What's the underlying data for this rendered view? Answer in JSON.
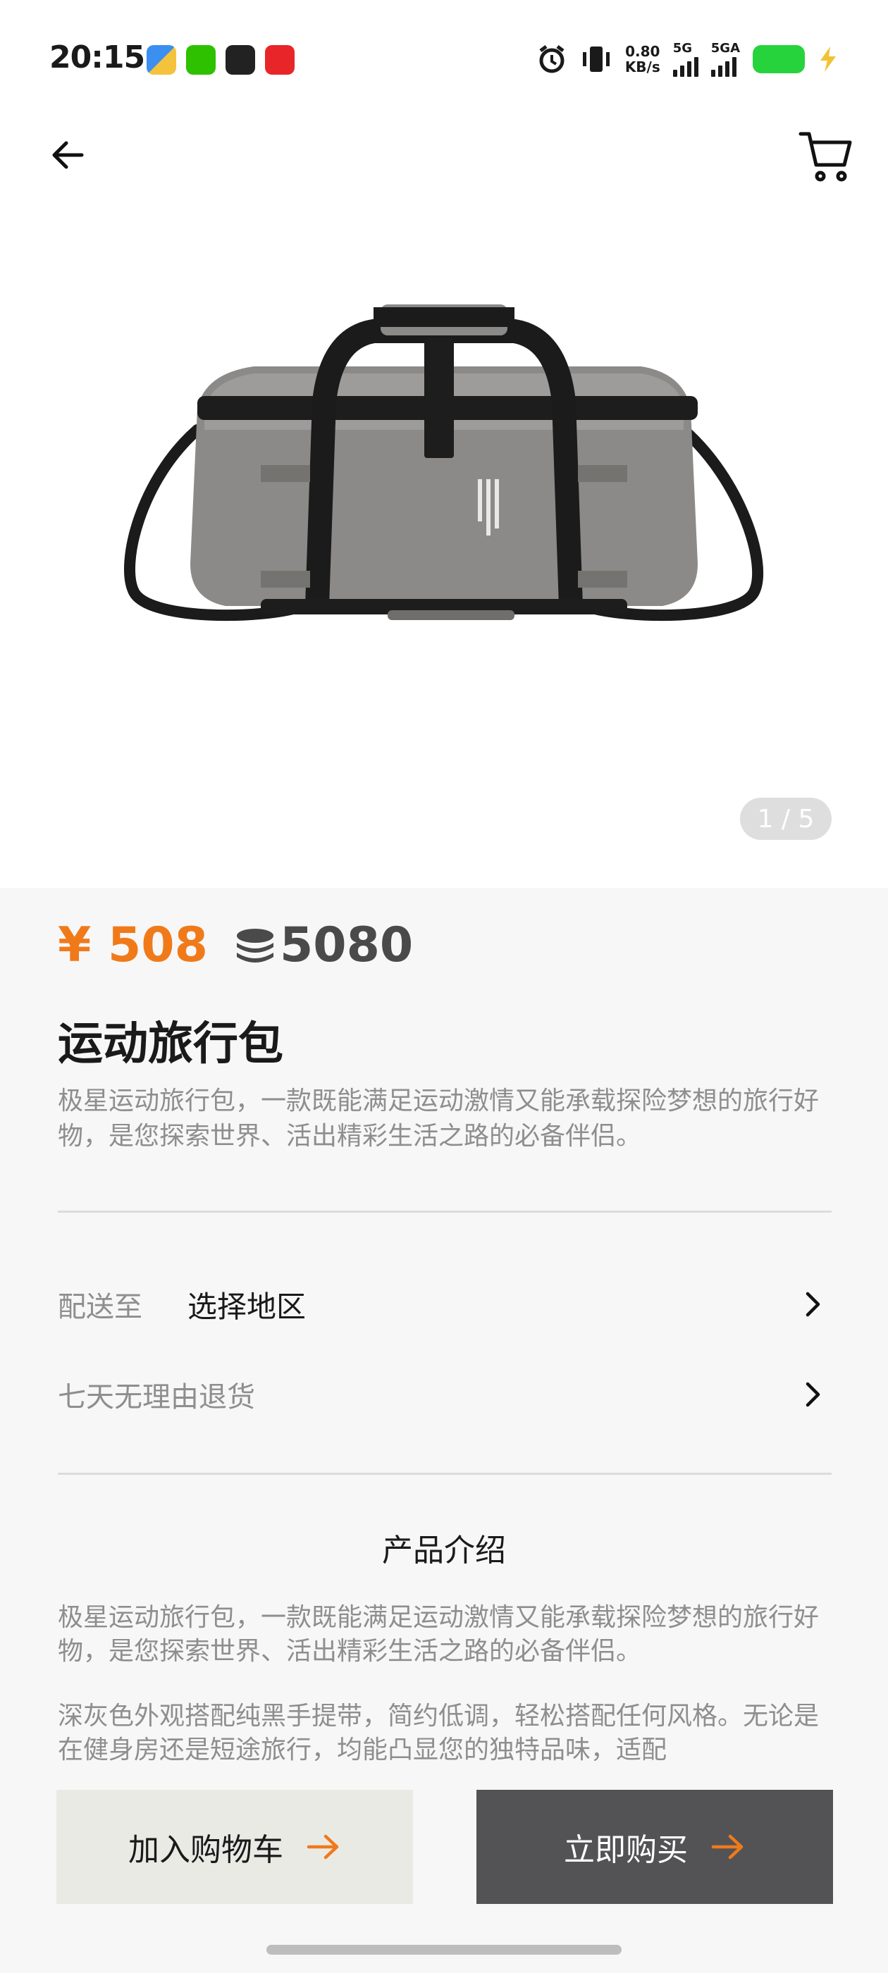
{
  "status_bar": {
    "time": "20:15",
    "net_speed_value": "0.80",
    "net_speed_unit": "KB/s",
    "signal1_label": "5G",
    "signal2_label": "5GA",
    "battery_color": "#27d33c"
  },
  "nav": {
    "back_icon": "arrow-left-icon",
    "cart_icon": "shopping-cart-icon"
  },
  "gallery": {
    "counter": "1 / 5"
  },
  "product": {
    "price": "¥ 508",
    "points": "5080",
    "title": "运动旅行包",
    "description": "极星运动旅行包，一款既能满足运动激情又能承载探险梦想的旅行好物，是您探索世界、活出精彩生活之路的必备伴侣。"
  },
  "options": {
    "delivery_label": "配送至",
    "delivery_value": "选择地区",
    "return_policy": "七天无理由退货"
  },
  "intro": {
    "title": "产品介绍",
    "paragraph1": "极星运动旅行包，一款既能满足运动激情又能承载探险梦想的旅行好物，是您探索世界、活出精彩生活之路的必备伴侣。",
    "paragraph2": "深灰色外观搭配纯黑手提带，简约低调，轻松搭配任何风格。无论是在健身房还是短途旅行，均能凸显您的独特品味，适配"
  },
  "actions": {
    "add_to_cart": "加入购物车",
    "buy_now": "立即购买"
  },
  "colors": {
    "accent": "#f07a1a",
    "dark_button": "#535356",
    "light_button": "#eaeae5"
  }
}
